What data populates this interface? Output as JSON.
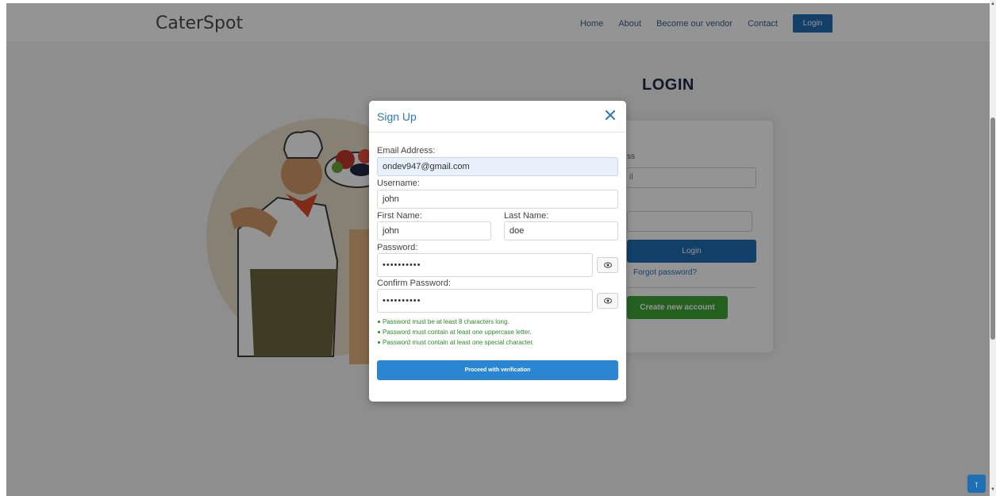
{
  "navbar": {
    "brand": "CaterSpot",
    "links": [
      "Home",
      "About",
      "Become our vendor",
      "Contact"
    ],
    "login_label": "Login"
  },
  "login_page": {
    "heading": "LOGIN",
    "email_label_fragment": "ss",
    "email_input_fragment": "il",
    "login_button": "Login",
    "forgot_password": "Forgot password?",
    "create_account": "Create new account"
  },
  "modal": {
    "title": "Sign Up",
    "close_icon": "close-icon",
    "email_label": "Email Address:",
    "email_value": "ondev947@gmail.com",
    "username_label": "Username:",
    "username_value": "john",
    "first_name_label": "First Name:",
    "first_name_value": "john",
    "last_name_label": "Last Name:",
    "last_name_value": "doe",
    "password_label": "Password:",
    "password_value": "••••••••••",
    "confirm_password_label": "Confirm Password:",
    "confirm_password_value": "••••••••••",
    "rules": [
      "Password must be at least 8 characters long.",
      "Password must contain at least one uppercase letter.",
      "Password must contain at least one special character."
    ],
    "proceed_button": "Proceed with verification"
  },
  "scroll_top_icon": "↑",
  "colors": {
    "primary": "#1f6fb3",
    "modal_accent": "#2a7ab8",
    "success": "#3fa83a",
    "rule_text": "#2a8a2a"
  }
}
